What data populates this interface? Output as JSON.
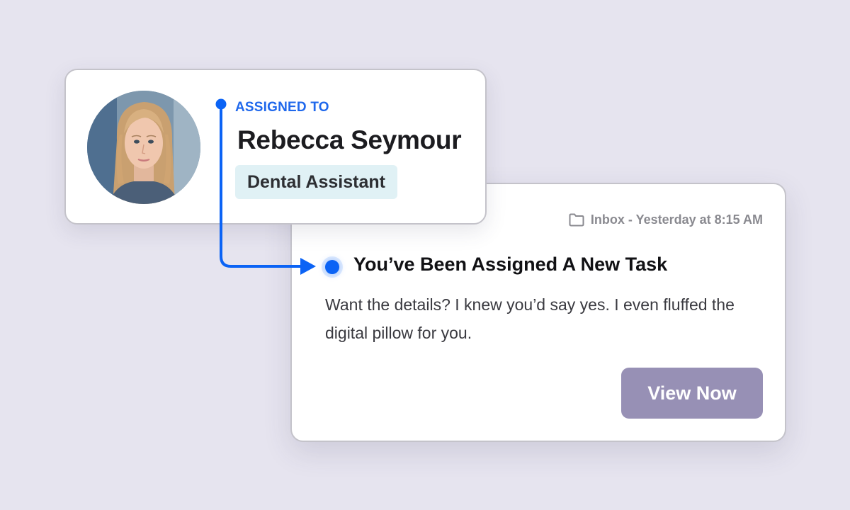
{
  "assignee": {
    "label": "ASSIGNED TO",
    "name": "Rebecca Seymour",
    "role": "Dental Assistant"
  },
  "notification": {
    "folder_icon": "folder-icon",
    "meta": "Inbox - Yesterday at 8:15 AM",
    "title": "You’ve Been Assigned A New Task",
    "body": "Want the details? I knew you’d say yes. I even fluffed the digital pillow for you.",
    "button_label": "View Now"
  },
  "colors": {
    "background": "#e6e4ef",
    "accent_blue": "#1f68ec",
    "badge_bg": "#e0f1f5",
    "button_bg": "#9790b5"
  }
}
